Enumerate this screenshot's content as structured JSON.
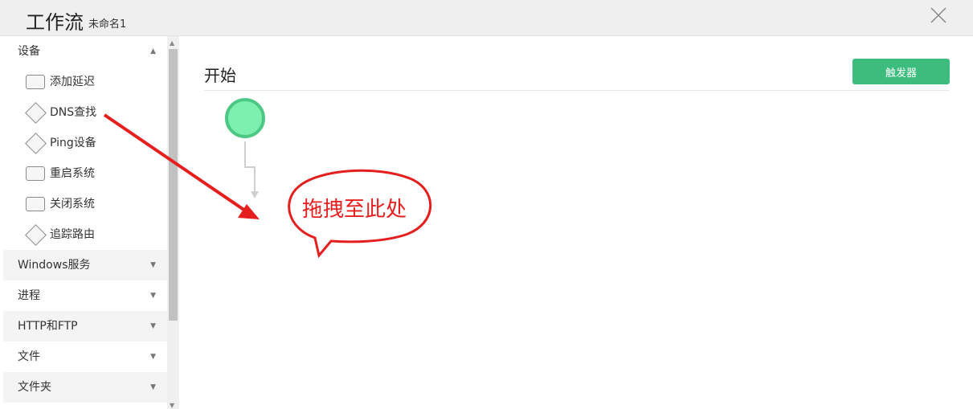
{
  "header": {
    "title": "工作流",
    "subtitle": "未命名1",
    "close_icon": "close-icon"
  },
  "sidebar": {
    "sections": [
      {
        "label": "设备",
        "expanded": true,
        "items": [
          {
            "label": "添加延迟",
            "shape": "rect"
          },
          {
            "label": "DNS查找",
            "shape": "diamond"
          },
          {
            "label": "Ping设备",
            "shape": "diamond"
          },
          {
            "label": "重启系统",
            "shape": "rect"
          },
          {
            "label": "关闭系统",
            "shape": "rect"
          },
          {
            "label": "追踪路由",
            "shape": "diamond"
          }
        ]
      },
      {
        "label": "Windows服务",
        "expanded": false
      },
      {
        "label": "进程",
        "expanded": false
      },
      {
        "label": "HTTP和FTP",
        "expanded": false
      },
      {
        "label": "文件",
        "expanded": false
      },
      {
        "label": "文件夹",
        "expanded": false
      }
    ]
  },
  "main": {
    "title": "开始",
    "trigger_button": "触发器"
  },
  "annotation": {
    "text": "拖拽至此处",
    "color": "#e51e1e"
  },
  "colors": {
    "accent": "#3dbd7d",
    "start_node": "#7df0b0",
    "start_node_border": "#4cc884"
  }
}
